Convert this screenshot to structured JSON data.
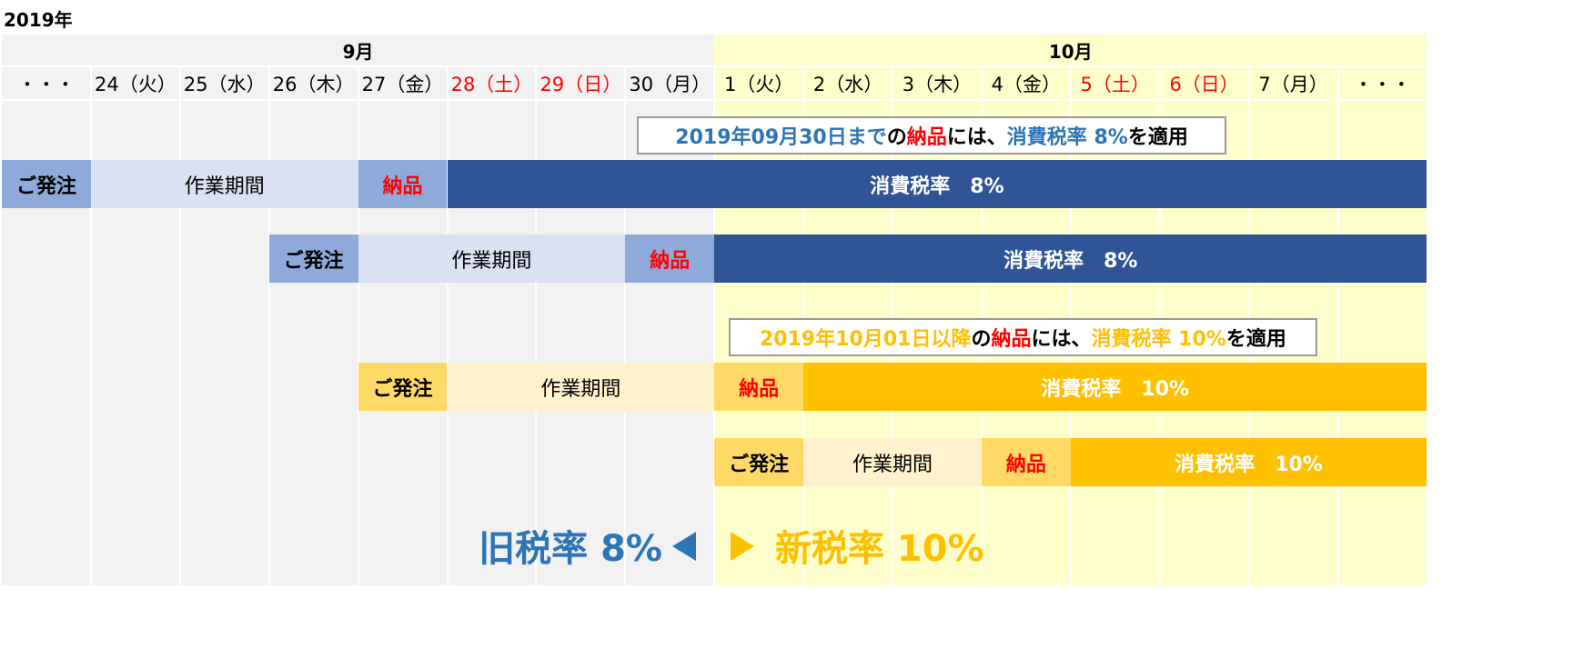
{
  "year_label": "2019年",
  "months": [
    {
      "label": "9月",
      "start": 0,
      "span": 8,
      "bg": "#f2f2f2"
    },
    {
      "label": "10月",
      "start": 8,
      "span": 8,
      "bg": "#ffffcc"
    }
  ],
  "days": [
    {
      "label": "・・・",
      "weekend": false
    },
    {
      "label": "24（火）",
      "weekend": false
    },
    {
      "label": "25（水）",
      "weekend": false
    },
    {
      "label": "26（木）",
      "weekend": false
    },
    {
      "label": "27（金）",
      "weekend": false
    },
    {
      "label": "28（土）",
      "weekend": true
    },
    {
      "label": "29（日）",
      "weekend": true
    },
    {
      "label": "30（月）",
      "weekend": false
    },
    {
      "label": "1（火）",
      "weekend": false
    },
    {
      "label": "2（水）",
      "weekend": false
    },
    {
      "label": "3（木）",
      "weekend": false
    },
    {
      "label": "4（金）",
      "weekend": false
    },
    {
      "label": "5（土）",
      "weekend": true
    },
    {
      "label": "6（日）",
      "weekend": true
    },
    {
      "label": "7（月）",
      "weekend": false
    },
    {
      "label": "・・・",
      "weekend": false
    }
  ],
  "labels": {
    "order": "ご発注",
    "work": "作業期間",
    "deliver": "納品",
    "tax8": "消費税率　8%",
    "tax10": "消費税率　10%"
  },
  "rows": [
    {
      "order_start": 0,
      "work_span": 3,
      "deliver_col": 4,
      "tax_end": 16,
      "scheme": "blue",
      "tax_label_key": "tax8"
    },
    {
      "order_start": 3,
      "work_span": 3,
      "deliver_col": 7,
      "tax_end": 16,
      "scheme": "blue",
      "tax_label_key": "tax8"
    },
    {
      "order_start": 4,
      "work_span": 3,
      "deliver_col": 8,
      "tax_end": 16,
      "scheme": "orange",
      "tax_label_key": "tax10"
    },
    {
      "order_start": 8,
      "work_span": 2,
      "deliver_col": 11,
      "tax_end": 16,
      "scheme": "orange",
      "tax_label_key": "tax10"
    }
  ],
  "schemes": {
    "blue": {
      "order_bg": "#8eaadb",
      "work_bg": "#d9e1f2",
      "deliver_bg": "#8eaadb",
      "tax_bg": "#2f5597"
    },
    "orange": {
      "order_bg": "#ffd966",
      "work_bg": "#fff2cc",
      "deliver_bg": "#ffd966",
      "tax_bg": "#ffc000"
    }
  },
  "notes": [
    {
      "col_start": 7.13,
      "col_end": 13.75,
      "segments": [
        {
          "text": "2019年09月30日まで",
          "color": "#2e75b6"
        },
        {
          "text": "の",
          "color": "#000000"
        },
        {
          "text": "納品",
          "color": "#ff0000"
        },
        {
          "text": "には、",
          "color": "#000000"
        },
        {
          "text": "消費税率 8%",
          "color": "#2e75b6"
        },
        {
          "text": "を適用",
          "color": "#000000"
        }
      ]
    },
    {
      "col_start": 8.16,
      "col_end": 14.77,
      "segments": [
        {
          "text": "2019年10月01日以降",
          "color": "#ffc000"
        },
        {
          "text": "の",
          "color": "#000000"
        },
        {
          "text": "納品",
          "color": "#ff0000"
        },
        {
          "text": "には、",
          "color": "#000000"
        },
        {
          "text": "消費税率 10%",
          "color": "#ffc000"
        },
        {
          "text": "を適用",
          "color": "#000000"
        }
      ]
    }
  ],
  "old_rate": {
    "text": "旧税率 8%",
    "color": "#2e75b6"
  },
  "new_rate": {
    "text": "新税率 10%",
    "color": "#ffc000"
  },
  "arrow_left_color": "#2e75b6",
  "arrow_right_color": "#ffc000"
}
